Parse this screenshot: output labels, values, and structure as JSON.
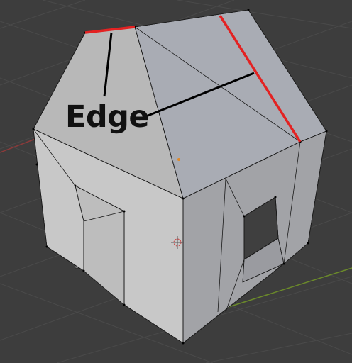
{
  "annotation": {
    "label": "Edge"
  },
  "colors": {
    "background": "#3d3d3d",
    "grid": "#454545",
    "axis_x": "#8a3a3a",
    "axis_y": "#5a7a2a",
    "highlighted_edge": "#e32222",
    "mesh_wire": "#1a1a1a",
    "callout_line": "#000000",
    "face_roof_front": "#b4b4b4",
    "face_roof_side": "#a7aab3",
    "face_front_wall": "#c9c9c9",
    "face_side_wall": "#a3a4a8",
    "origin_dot": "#e08a2a"
  },
  "icons": {
    "origin": "origin-dot-icon",
    "cursor": "3d-cursor-icon"
  }
}
